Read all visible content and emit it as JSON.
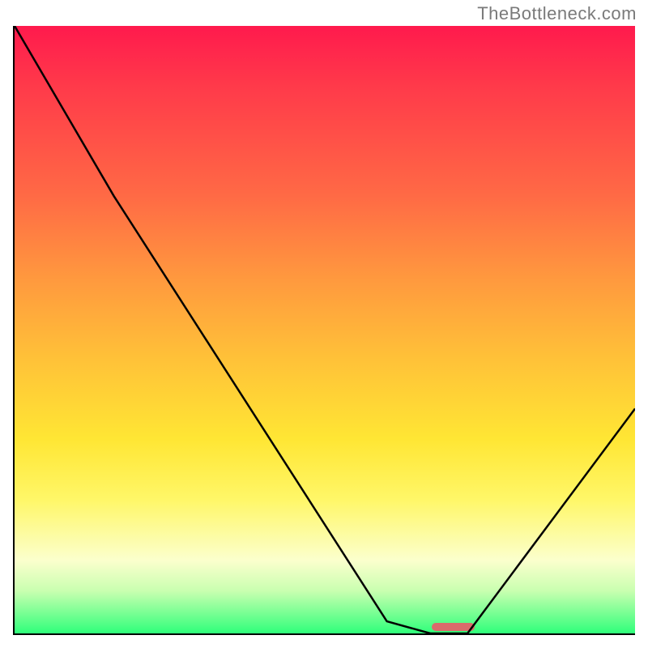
{
  "watermark": "TheBottleneck.com",
  "chart_data": {
    "type": "line",
    "title": "",
    "xlabel": "",
    "ylabel": "",
    "xlim": [
      0,
      100
    ],
    "ylim": [
      0,
      100
    ],
    "x": [
      0,
      16,
      60,
      67,
      73,
      100
    ],
    "values": [
      100,
      72,
      2,
      0,
      0,
      37
    ],
    "optimum_band_x_pct": [
      67,
      74
    ],
    "gradient_stops": [
      {
        "pct": 0,
        "color": "#ff1a4d"
      },
      {
        "pct": 28,
        "color": "#ff6a45"
      },
      {
        "pct": 55,
        "color": "#ffc238"
      },
      {
        "pct": 78,
        "color": "#fff768"
      },
      {
        "pct": 93,
        "color": "#c9ffb0"
      },
      {
        "pct": 100,
        "color": "#2fff7a"
      }
    ]
  }
}
